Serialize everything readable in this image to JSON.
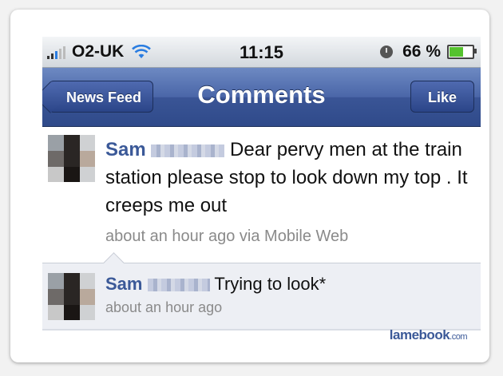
{
  "status_bar": {
    "carrier": "O2-UK",
    "time": "11:15",
    "battery": "66 %",
    "battery_level": 0.66
  },
  "nav": {
    "back_label": "News Feed",
    "title": "Comments",
    "like_label": "Like"
  },
  "post": {
    "author": "Sam",
    "text": "Dear pervy men at the train station please stop  to look down my top . It creeps me out",
    "meta": "about an hour ago via Mobile Web"
  },
  "comments": [
    {
      "author": "Sam",
      "text": "Trying to look*",
      "meta": "about an hour ago"
    }
  ],
  "watermark": {
    "brand": "lamebook",
    "suffix": ".com"
  },
  "colors": {
    "nav_blue": "#3b5998",
    "author_blue": "#3b5998",
    "meta_gray": "#8a8a8a",
    "comment_bg": "#edeff4",
    "battery_green": "#55c22e"
  }
}
